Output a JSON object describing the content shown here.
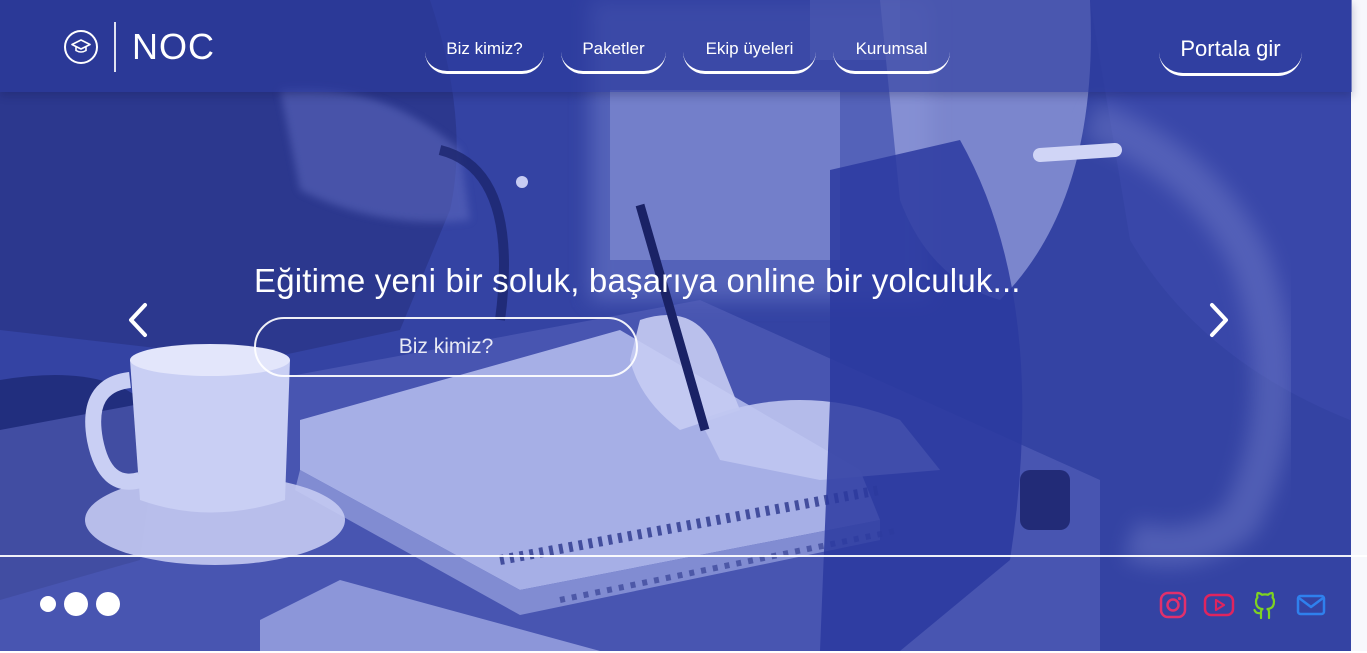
{
  "brand": {
    "name": "NOC",
    "logo_icon": "graduation-cap-icon"
  },
  "nav": {
    "items": [
      {
        "label": "Biz kimiz?"
      },
      {
        "label": "Paketler"
      },
      {
        "label": "Ekip üyeleri"
      },
      {
        "label": "Kurumsal"
      }
    ],
    "portal_label": "Portala gir"
  },
  "hero": {
    "headline": "Eğitime yeni bir soluk, başarıya online bir yolculuk...",
    "cta_label": "Biz kimiz?",
    "prev_icon": "chevron-left-icon",
    "next_icon": "chevron-right-icon",
    "overlay_color": "#3443a3"
  },
  "carousel": {
    "slide_count": 3,
    "active_index": 0
  },
  "socials": [
    {
      "name": "instagram-icon",
      "color": "#e1306c"
    },
    {
      "name": "youtube-icon",
      "color": "#e0245e"
    },
    {
      "name": "github-icon",
      "color": "#7ed321"
    },
    {
      "name": "mail-icon",
      "color": "#2f80ed"
    }
  ]
}
